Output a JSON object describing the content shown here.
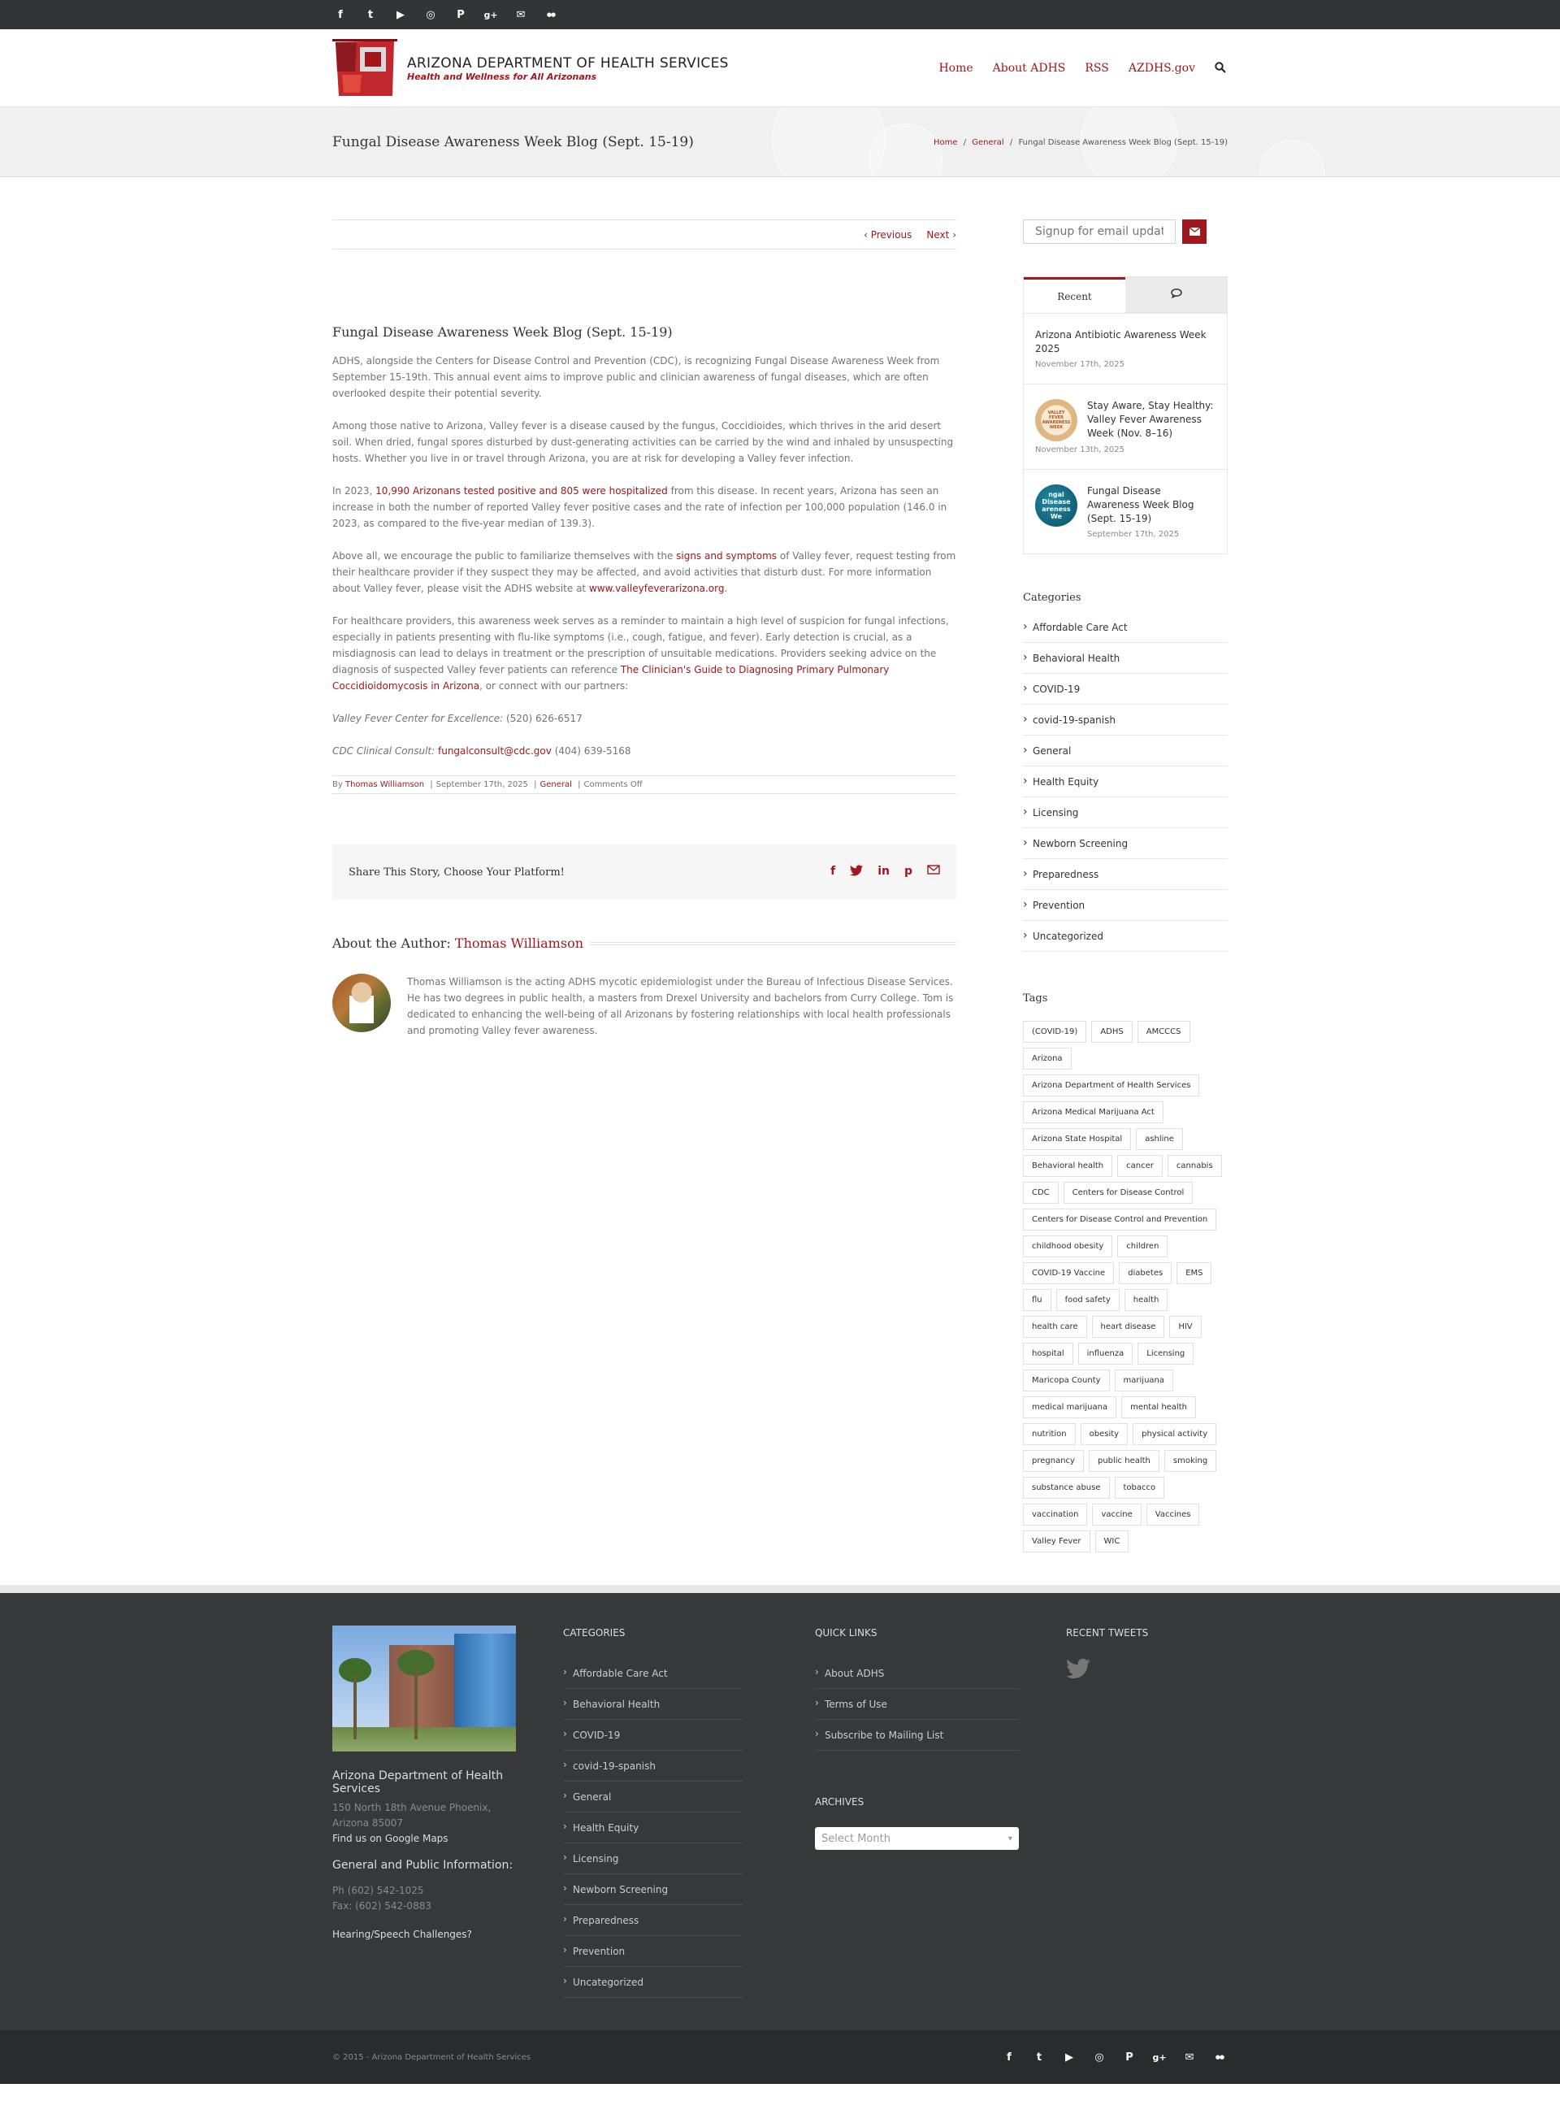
{
  "social": [
    "f",
    "t",
    "yt",
    "ig",
    "p",
    "g+",
    "mail",
    "flickr"
  ],
  "logo": {
    "title": "ARIZONA DEPARTMENT OF HEALTH SERVICES",
    "subtitle": "Health and Wellness for All Arizonans"
  },
  "nav": [
    "Home",
    "About ADHS",
    "RSS",
    "AZDHS.gov"
  ],
  "page_title": "Fungal Disease Awareness Week Blog (Sept. 15-19)",
  "breadcrumb": {
    "home": "Home",
    "sep": "/",
    "cat": "General",
    "current": "Fungal Disease Awareness Week Blog (Sept. 15-19)"
  },
  "pn": {
    "prev": "Previous",
    "next": "Next"
  },
  "post": {
    "title": "Fungal Disease Awareness Week Blog (Sept. 15-19)",
    "p1": "ADHS, alongside the Centers for Disease Control and Prevention (CDC), is recognizing Fungal Disease Awareness Week from September 15-19th. This annual event aims to improve public and clinician awareness of fungal diseases, which are often overlooked despite their potential severity.",
    "p2": "Among those native to Arizona, Valley fever is a disease caused by the fungus, Coccidioides, which thrives in the arid desert soil. When dried, fungal spores disturbed by dust-generating activities can be carried by the wind and inhaled by unsuspecting hosts. Whether you live in or travel through Arizona, you are at risk for developing a Valley fever infection.",
    "p3a": "In 2023, ",
    "p3link": "10,990 Arizonans tested positive and 805 were hospitalized",
    "p3b": " from this disease. In recent years, Arizona has seen an increase in both the number of reported Valley fever positive cases and the rate of infection per 100,000 population (146.0 in 2023, as compared to the five-year median of 139.3).",
    "p4a": "Above all, we encourage the public to familiarize themselves with the ",
    "p4link": "signs and symptoms",
    "p4b": " of Valley fever, request testing from their healthcare provider if they suspect they may be affected, and avoid activities that disturb dust. For more information about Valley fever, please visit the ADHS website at ",
    "p4link2": "www.valleyfeverarizona.org",
    "p4c": ".",
    "p5a": "For healthcare providers, this awareness week serves as a reminder to maintain a high level of suspicion for fungal infections, especially in patients presenting with flu-like symptoms (i.e., cough, fatigue, and fever). Early detection is crucial, as a misdiagnosis can lead to delays in treatment or the prescription of unsuitable medications. Providers seeking advice on the diagnosis of suspected Valley fever patients can reference ",
    "p5link": "The Clinician's Guide to Diagnosing Primary Pulmonary Coccidioidomycosis in Arizona",
    "p5b": ", or connect with our partners:",
    "p6label": "Valley Fever Center for Excellence:",
    "p6": " (520) 626-6517",
    "p7label": "CDC Clinical Consult:",
    "p7link": "fungalconsult@cdc.gov",
    "p7": " (404) 639-5168"
  },
  "meta": {
    "by": "By ",
    "author": "Thomas Williamson",
    "date": "September 17th, 2025",
    "cat": "General",
    "comments": "Comments Off"
  },
  "share": {
    "text": "Share This Story, Choose Your Platform!",
    "icons": [
      "f",
      "t",
      "in",
      "p",
      "mail"
    ]
  },
  "about": {
    "label": "About the Author: ",
    "name": "Thomas Williamson",
    "bio": "Thomas Williamson is the acting ADHS mycotic epidemiologist under the Bureau of Infectious Disease Services. He has two degrees in public health, a masters from Drexel University and bachelors from Curry College. Tom is dedicated to enhancing the well-being of all Arizonans by fostering relationships with local health professionals and promoting Valley fever awareness."
  },
  "sidebar": {
    "signup_placeholder": "Signup for email updates",
    "tab_recent": "Recent",
    "recent": [
      {
        "title": "Arizona Antibiotic Awareness Week 2025",
        "date": "November 17th, 2025"
      },
      {
        "title": "Stay Aware, Stay Healthy: Valley Fever Awareness Week (Nov. 8–16)",
        "date": "November 13th, 2025",
        "thumb": "VALLEY FEVER AWARENESS WEEK"
      },
      {
        "title": "Fungal Disease Awareness Week Blog (Sept. 15-19)",
        "date": "September 17th, 2025",
        "thumb": "ngal Disease areness We"
      }
    ],
    "categories_title": "Categories",
    "categories": [
      "Affordable Care Act",
      "Behavioral Health",
      "COVID-19",
      "covid-19-spanish",
      "General",
      "Health Equity",
      "Licensing",
      "Newborn Screening",
      "Preparedness",
      "Prevention",
      "Uncategorized"
    ],
    "tags_title": "Tags",
    "tags": [
      "(COVID-19)",
      "ADHS",
      "AMCCCS",
      "Arizona",
      "Arizona Department of Health Services",
      "Arizona Medical Marijuana Act",
      "Arizona State Hospital",
      "ashline",
      "Behavioral health",
      "cancer",
      "cannabis",
      "CDC",
      "Centers for Disease Control",
      "Centers for Disease Control and Prevention",
      "childhood obesity",
      "children",
      "COVID-19 Vaccine",
      "diabetes",
      "EMS",
      "flu",
      "food safety",
      "health",
      "health care",
      "heart disease",
      "HIV",
      "hospital",
      "influenza",
      "Licensing",
      "Maricopa County",
      "marijuana",
      "medical marijuana",
      "mental health",
      "nutrition",
      "obesity",
      "physical activity",
      "pregnancy",
      "public health",
      "smoking",
      "substance abuse",
      "tobacco",
      "vaccination",
      "vaccine",
      "Vaccines",
      "Valley Fever",
      "WIC"
    ]
  },
  "footer": {
    "org": "Arizona Department of Health Services",
    "address": "150 North 18th Avenue Phoenix, Arizona 85007",
    "maps": "Find us on Google Maps",
    "gpi": "General and Public Information:",
    "ph": "Ph (602) 542-1025",
    "fax": "Fax: (602) 542-0883",
    "hearing": "Hearing/Speech Challenges?",
    "categories_title": "CATEGORIES",
    "categories": [
      "Affordable Care Act",
      "Behavioral Health",
      "COVID-19",
      "covid-19-spanish",
      "General",
      "Health Equity",
      "Licensing",
      "Newborn Screening",
      "Preparedness",
      "Prevention",
      "Uncategorized"
    ],
    "quick_title": "QUICK LINKS",
    "quick": [
      "About ADHS",
      "Terms of Use",
      "Subscribe to Mailing List"
    ],
    "archives_title": "ARCHIVES",
    "archives_select": "Select Month",
    "tweets_title": "RECENT TWEETS",
    "copyright": "© 2015 - Arizona Department of Health Services"
  },
  "colors": {
    "accent": "#a0181e",
    "topbar": "#333436",
    "footer": "#363839",
    "bottombar": "#2a2b2d"
  }
}
